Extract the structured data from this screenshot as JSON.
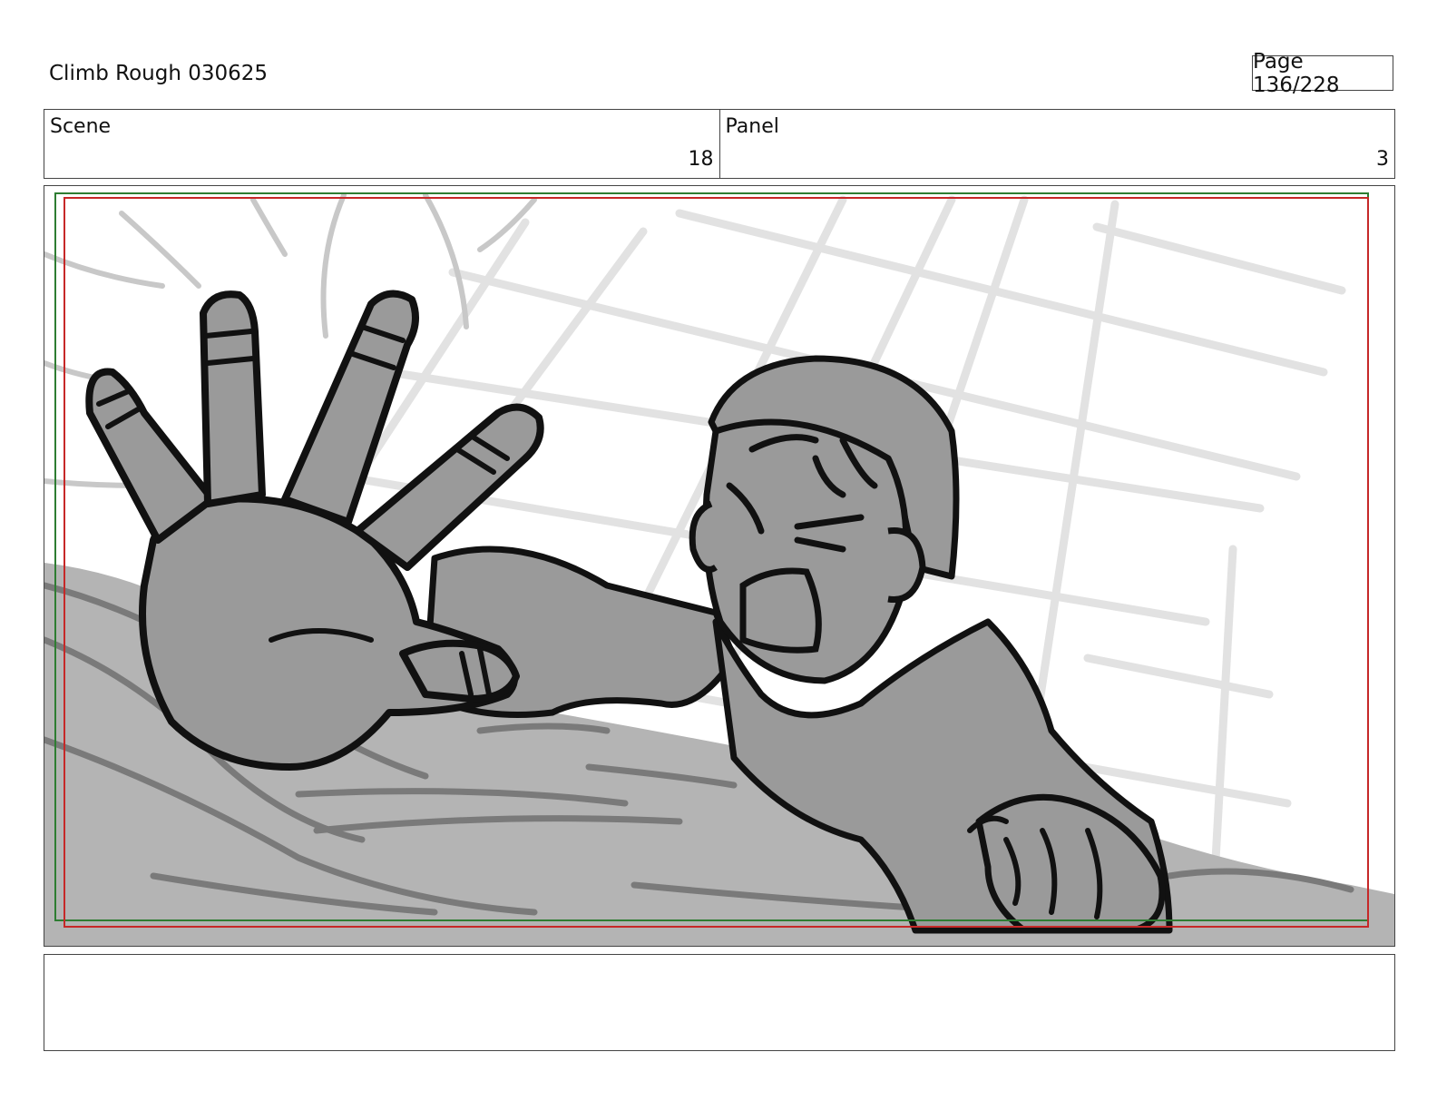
{
  "header": {
    "title": "Climb Rough 030625",
    "page": "Page 136/228"
  },
  "info": {
    "scene_label": "Scene",
    "scene_value": "18",
    "panel_label": "Panel",
    "panel_value": "3"
  },
  "frame": {
    "safe_color": "#2e7d32",
    "action_color": "#c62828",
    "fill_dark": "#9a9a9a",
    "fill_light": "#b4b4b4",
    "grid_color": "#e2e2e2",
    "ink_color": "#111111"
  },
  "notes": {
    "text": ""
  }
}
